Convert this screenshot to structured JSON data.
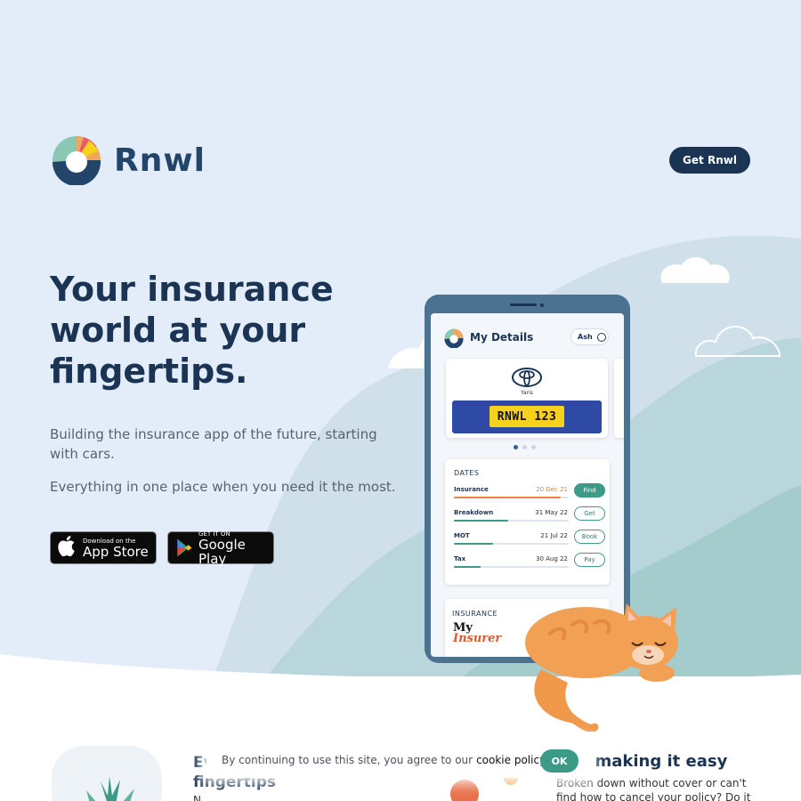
{
  "brand": {
    "name": "Rnwl",
    "cta_label": "Get Rnwl"
  },
  "hero": {
    "headline": [
      "Your insurance",
      "world at your",
      "fingertips."
    ],
    "subtext_1": "Building the insurance app of the future, starting with cars.",
    "subtext_2": "Everything in one place when you need it the most.",
    "app_store": {
      "small": "Download on the",
      "big": "App Store"
    },
    "google_play": {
      "small": "GET IT ON",
      "big": "Google Play"
    }
  },
  "phone": {
    "title": "My Details",
    "user": "Ash",
    "car": {
      "model": "Yaris",
      "plate": "RNWL 123"
    },
    "carousel": {
      "pages": 3,
      "active": 0
    },
    "dates": {
      "title": "DATES",
      "rows": [
        {
          "label": "Insurance",
          "date": "20 Dec 21",
          "action": "Find",
          "progress": 0.93,
          "warn": true
        },
        {
          "label": "Breakdown",
          "date": "31 May 22",
          "action": "Get",
          "progress": 0.47,
          "warn": false
        },
        {
          "label": "MOT",
          "date": "21 Jul 22",
          "action": "Book",
          "progress": 0.34,
          "warn": false
        },
        {
          "label": "Tax",
          "date": "30 Aug 22",
          "action": "Pay",
          "progress": 0.23,
          "warn": false
        }
      ]
    },
    "insurance": {
      "title": "INSURANCE",
      "insurer_line1": "My",
      "insurer_line2": "Insurer"
    }
  },
  "lower": {
    "left_title_1": "Ev",
    "left_title_2": "fingertips",
    "left_text": "N",
    "right_title": "e making it easy",
    "right_text": "Broken down without cover or can't find how to cancel your policy? Do it"
  },
  "cookie_banner": {
    "text": "By continuing to use this site, you agree to our",
    "link": "cookie policy",
    "ok": "OK"
  },
  "colors": {
    "navy": "#1c3453",
    "teal": "#3c9b86",
    "orange": "#f0813b",
    "hero_bg": "#e3edfa",
    "plate_yellow": "#f6d21c",
    "plate_blue": "#2f4aa5"
  }
}
